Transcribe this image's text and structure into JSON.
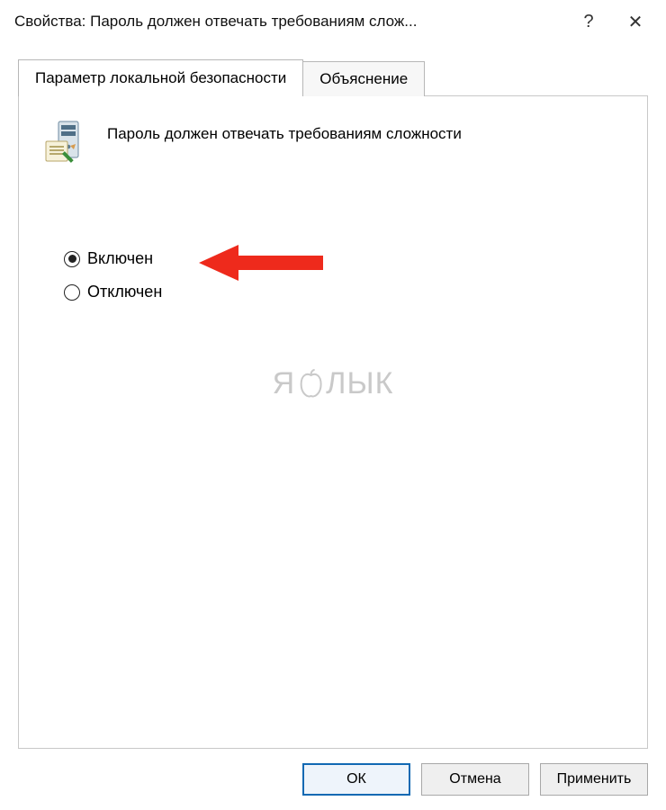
{
  "titlebar": {
    "title": "Свойства: Пароль должен отвечать требованиям слож...",
    "help_symbol": "?",
    "close_symbol": "✕"
  },
  "tabs": {
    "active": "Параметр локальной безопасности",
    "inactive": "Объяснение"
  },
  "policy": {
    "title": "Пароль должен отвечать требованиям сложности"
  },
  "radios": {
    "enabled": "Включен",
    "disabled": "Отключен"
  },
  "watermark": {
    "text_left": "Я",
    "text_right": "ЛЫК"
  },
  "buttons": {
    "ok": "ОК",
    "cancel": "Отмена",
    "apply": "Применить"
  }
}
